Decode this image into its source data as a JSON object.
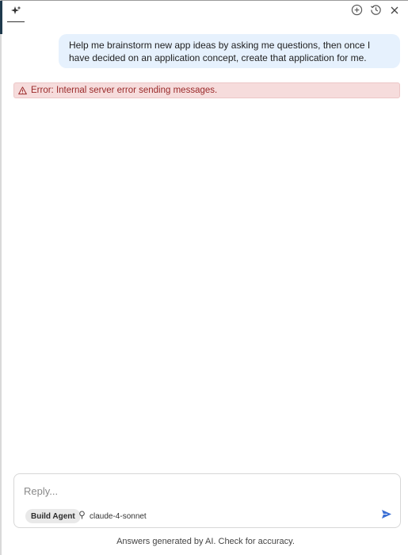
{
  "header": {
    "icons": [
      "sparkle-icon",
      "add-circle-icon",
      "history-icon",
      "close-icon"
    ]
  },
  "conversation": {
    "user_message": "Help me brainstorm new app ideas by asking me questions, then once I have decided on an application concept, create that application for me.",
    "error_text": "Error: Internal server error sending messages."
  },
  "composer": {
    "placeholder": "Reply...",
    "value": "",
    "agent_label": "Build Agent",
    "model_label": "claude-4-sonnet"
  },
  "footer": {
    "disclaimer": "Answers generated by AI. Check for accuracy."
  },
  "colors": {
    "user_bubble": "#e6f1fd",
    "error_bg": "#f6dcdc",
    "error_text": "#9a2a2a",
    "send_icon": "#3b6fd4"
  }
}
